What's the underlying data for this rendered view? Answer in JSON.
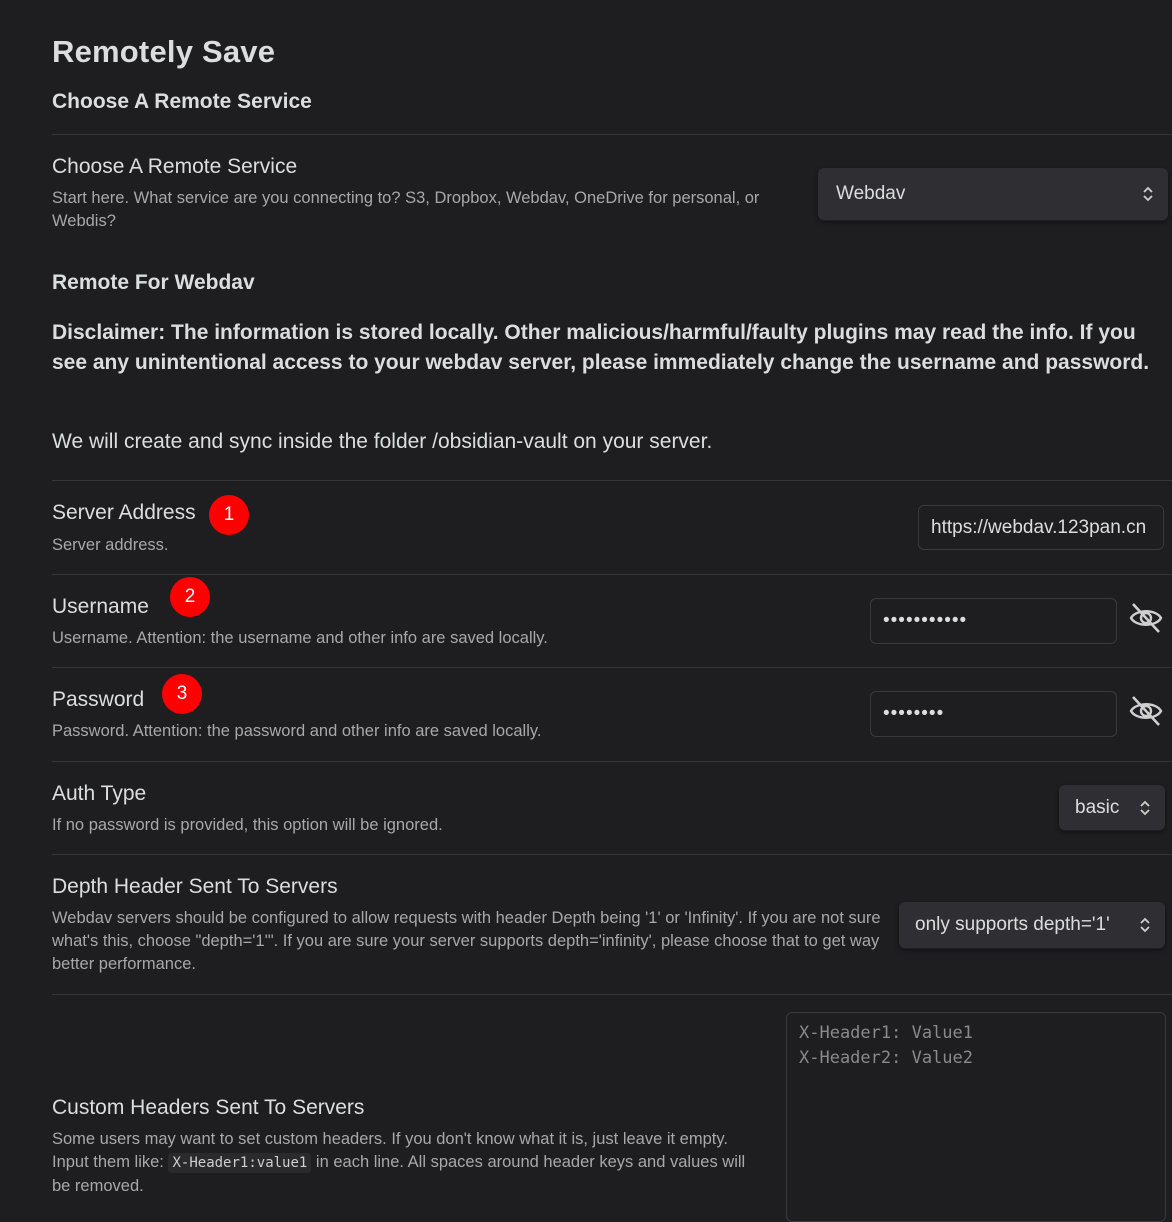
{
  "title": "Remotely Save",
  "section_heading": "Choose A Remote Service",
  "service": {
    "name": "Choose A Remote Service",
    "desc": "Start here. What service are you connecting to? S3, Dropbox, Webdav, OneDrive for personal, or Webdis?",
    "selected": "Webdav"
  },
  "remote_heading": "Remote For Webdav",
  "disclaimer": "Disclaimer: The information is stored locally. Other malicious/harmful/faulty plugins may read the info. If you see any unintentional access to your webdav server, please immediately change the username and password.",
  "folder_note": "We will create and sync inside the folder /obsidian-vault on your server.",
  "server": {
    "name": "Server Address",
    "desc": "Server address.",
    "value": "https://webdav.123pan.cn",
    "badge": "1"
  },
  "username": {
    "name": "Username",
    "desc": "Username. Attention: the username and other info are saved locally.",
    "value": "•••••••••••",
    "badge": "2"
  },
  "password": {
    "name": "Password",
    "desc": "Password. Attention: the password and other info are saved locally.",
    "value": "••••••••",
    "badge": "3"
  },
  "auth": {
    "name": "Auth Type",
    "desc": "If no password is provided, this option will be ignored.",
    "selected": "basic"
  },
  "depth": {
    "name": "Depth Header Sent To Servers",
    "desc": "Webdav servers should be configured to allow requests with header Depth being '1' or 'Infinity'. If you are not sure what's this, choose \"depth='1'\". If you are sure your server supports depth='infinity', please choose that to get way better performance.",
    "selected": "only supports depth='1'"
  },
  "custom_headers": {
    "name": "Custom Headers Sent To Servers",
    "desc_before": "Some users may want to set custom headers. If you don't know what it is, just leave it empty. Input them like: ",
    "desc_code": "X-Header1:value1",
    "desc_after": " in each line. All spaces around header keys and values will be removed.",
    "placeholder": "X-Header1: Value1\nX-Header2: Value2"
  },
  "colors": {
    "background": "#1e1e20",
    "badge": "#ff0000",
    "text": "#dcddde",
    "muted": "#a8a8a8"
  }
}
